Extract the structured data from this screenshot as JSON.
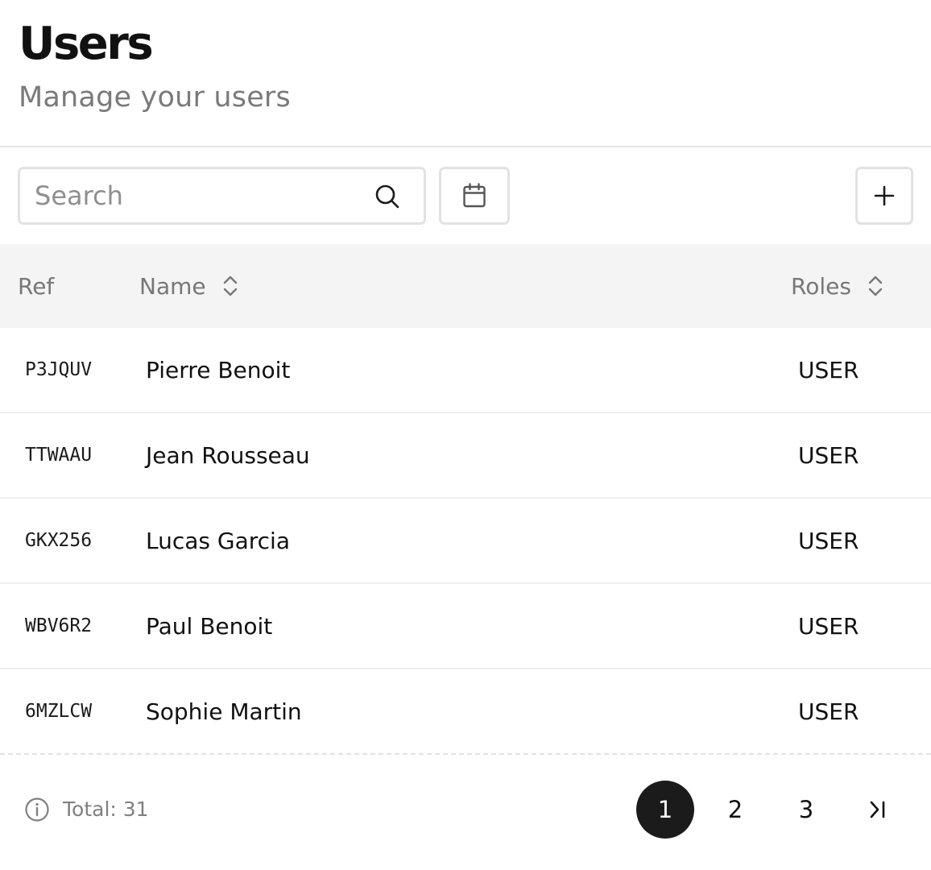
{
  "header": {
    "title": "Users",
    "subtitle": "Manage your users"
  },
  "toolbar": {
    "search_placeholder": "Search",
    "search_icon": "search-icon",
    "calendar_icon": "calendar-icon",
    "add_icon": "plus-icon"
  },
  "table": {
    "columns": {
      "ref": "Ref",
      "name": "Name",
      "roles": "Roles"
    },
    "rows": [
      {
        "ref": "P3JQUV",
        "name": "Pierre Benoit",
        "role": "USER"
      },
      {
        "ref": "TTWAAU",
        "name": "Jean Rousseau",
        "role": "USER"
      },
      {
        "ref": "GKX256",
        "name": "Lucas Garcia",
        "role": "USER"
      },
      {
        "ref": "WBV6R2",
        "name": "Paul Benoit",
        "role": "USER"
      },
      {
        "ref": "6MZLCW",
        "name": "Sophie Martin",
        "role": "USER"
      }
    ]
  },
  "footer": {
    "total_label": "Total: 31",
    "info_icon": "info-icon",
    "pages": [
      "1",
      "2",
      "3"
    ],
    "current_page": "1",
    "last_page_icon": "last-page-icon"
  },
  "colors": {
    "active_page_bg": "#1b1b1b",
    "header_bg": "#f4f4f4",
    "border": "#e2e2e2",
    "muted_text": "#777777"
  }
}
